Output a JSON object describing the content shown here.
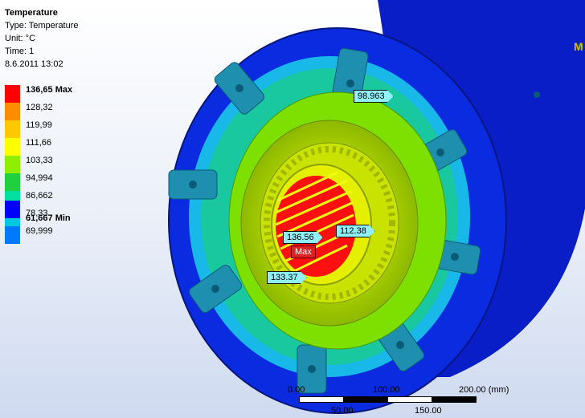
{
  "result": {
    "title": "Temperature",
    "type_line": "Type: Temperature",
    "unit_line": "Unit: °C",
    "time_line": "Time: 1",
    "date_line": "8.6.2011 13:02"
  },
  "legend": {
    "max_label": "136,65 Max",
    "labels": [
      "128,32",
      "119,99",
      "111,66",
      "103,33",
      "94,994",
      "86,662",
      "78,33",
      "69,999"
    ],
    "min_label": "61,667 Min",
    "colors": [
      "#ff0000",
      "#ff8c00",
      "#ffc800",
      "#ffff00",
      "#90ee00",
      "#20d040",
      "#00e0a0",
      "#00c8e0",
      "#0078ff",
      "#0000ff"
    ]
  },
  "probes": {
    "p1": "98.963",
    "p2": "136.56",
    "p3": "112.38",
    "p4": "133.37",
    "max_tag": "Max"
  },
  "scale": {
    "t0": "0.00",
    "t100": "100.00",
    "t200": "200.00 (mm)",
    "t50": "50.00",
    "t150": "150.00"
  },
  "corner_glyph": "M"
}
